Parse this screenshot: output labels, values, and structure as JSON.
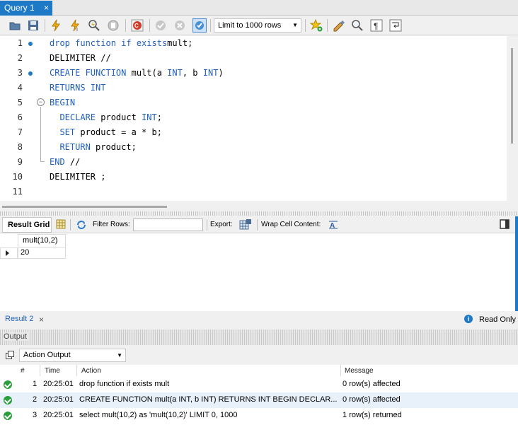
{
  "query_tab": {
    "label": "Query 1",
    "close": "×"
  },
  "toolbar": {
    "limit_value": "Limit to 1000 rows"
  },
  "editor": {
    "line_numbers": [
      "1",
      "2",
      "3",
      "4",
      "5",
      "6",
      "7",
      "8",
      "9",
      "10",
      "11"
    ],
    "lines": [
      [
        [
          "kw",
          "drop function if exists"
        ],
        [
          "",
          "mult;"
        ]
      ],
      [
        [
          "",
          "DELIMITER //"
        ]
      ],
      [
        [
          "kw",
          "CREATE FUNCTION"
        ],
        [
          "",
          " mult(a "
        ],
        [
          "kw",
          "INT"
        ],
        [
          "",
          ", b "
        ],
        [
          "kw",
          "INT"
        ],
        [
          "",
          ")"
        ]
      ],
      [
        [
          "kw",
          "RETURNS INT"
        ]
      ],
      [
        [
          "kw",
          "BEGIN"
        ]
      ],
      [
        [
          "",
          "  "
        ],
        [
          "kw",
          "DECLARE"
        ],
        [
          "",
          " product "
        ],
        [
          "kw",
          "INT"
        ],
        [
          "",
          ";"
        ]
      ],
      [
        [
          "",
          "  "
        ],
        [
          "kw",
          "SET"
        ],
        [
          "",
          " product = a * b;"
        ]
      ],
      [
        [
          "",
          "  "
        ],
        [
          "kw",
          "RETURN"
        ],
        [
          "",
          " product;"
        ]
      ],
      [
        [
          "kw",
          "END"
        ],
        [
          "",
          " //"
        ]
      ],
      [
        [
          "",
          "DELIMITER ;"
        ]
      ],
      []
    ]
  },
  "result_toolbar": {
    "result_grid_label": "Result Grid",
    "filter_rows_label": "Filter Rows:",
    "filter_value": "",
    "export_label": "Export:",
    "wrap_label": "Wrap Cell Content:"
  },
  "grid": {
    "columns": [
      "mult(10,2)"
    ],
    "rows": [
      [
        "20"
      ]
    ]
  },
  "result_tabs": {
    "label": "Result 2",
    "close": "×",
    "read_only": "Read Only"
  },
  "output": {
    "label": "Output",
    "action_select": "Action Output",
    "headers": {
      "num": "#",
      "time": "Time",
      "action": "Action",
      "message": "Message"
    },
    "rows": [
      {
        "num": "1",
        "time": "20:25:01",
        "action": "drop function if exists mult",
        "message": "0 row(s) affected"
      },
      {
        "num": "2",
        "time": "20:25:01",
        "action": "CREATE FUNCTION mult(a INT, b INT) RETURNS INT BEGIN   DECLAR...",
        "message": "0 row(s) affected"
      },
      {
        "num": "3",
        "time": "20:25:01",
        "action": "select mult(10,2) as 'mult(10,2)' LIMIT 0, 1000",
        "message": "1 row(s) returned"
      }
    ]
  },
  "colors": {
    "accent": "#1e7ac7",
    "keyword": "#1e5fbf",
    "ok": "#2a9d3c",
    "selected_row": "#e8f0fa"
  }
}
